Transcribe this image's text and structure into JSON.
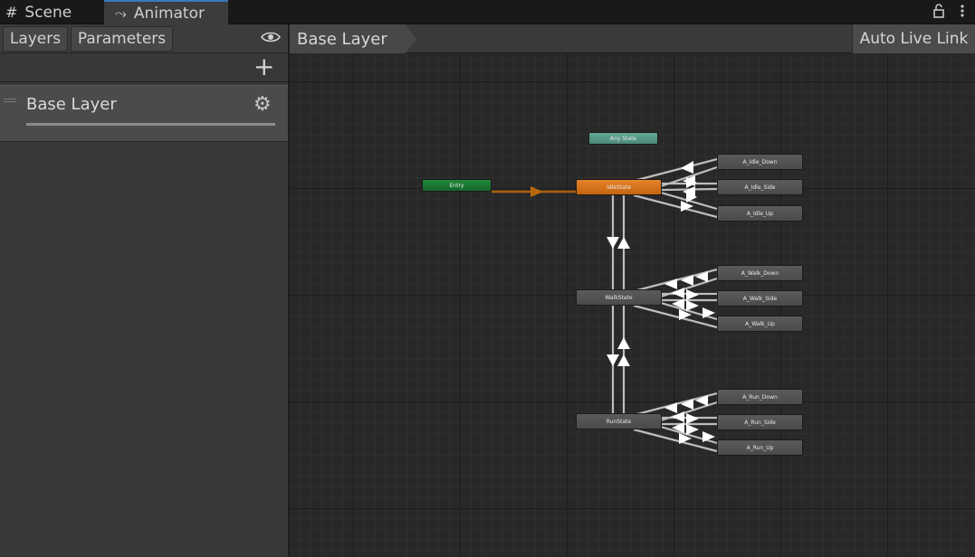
{
  "tabs": {
    "scene": {
      "label": "Scene",
      "icon": "grid-icon"
    },
    "animator": {
      "label": "Animator",
      "icon": "animator-icon"
    }
  },
  "window_controls": {
    "lock": "lock-icon",
    "menu": "kebab-menu-icon"
  },
  "left_panel": {
    "layers_button": "Layers",
    "parameters_button": "Parameters",
    "eye_icon": "eye-icon",
    "add_icon": "plus-icon",
    "layer": {
      "name": "Base Layer",
      "settings_icon": "gear-icon"
    }
  },
  "breadcrumb": {
    "label": "Base Layer",
    "live_link": "Auto Live Link"
  },
  "graph": {
    "nodes": {
      "any_state": "Any State",
      "entry": "Entry",
      "idle_state": "IdleState",
      "walk_state": "WalkState",
      "run_state": "RunState",
      "a_idle_down": "A_Idle_Down",
      "a_idle_side": "A_Idle_Side",
      "a_idle_up": "A_Idle_Up",
      "a_walk_down": "A_Walk_Down",
      "a_walk_side": "A_Walk_Side",
      "a_walk_up": "A_Walk_Up",
      "a_run_down": "A_Run_Down",
      "a_run_side": "A_Run_Side",
      "a_run_up": "A_Run_Up"
    },
    "colors": {
      "default_state": "#e8842a",
      "entry": "#1f8a3c",
      "any_state": "#62a795",
      "state": "#555555",
      "transition": "#d0d0d0",
      "entry_transition": "#b4660f"
    }
  }
}
